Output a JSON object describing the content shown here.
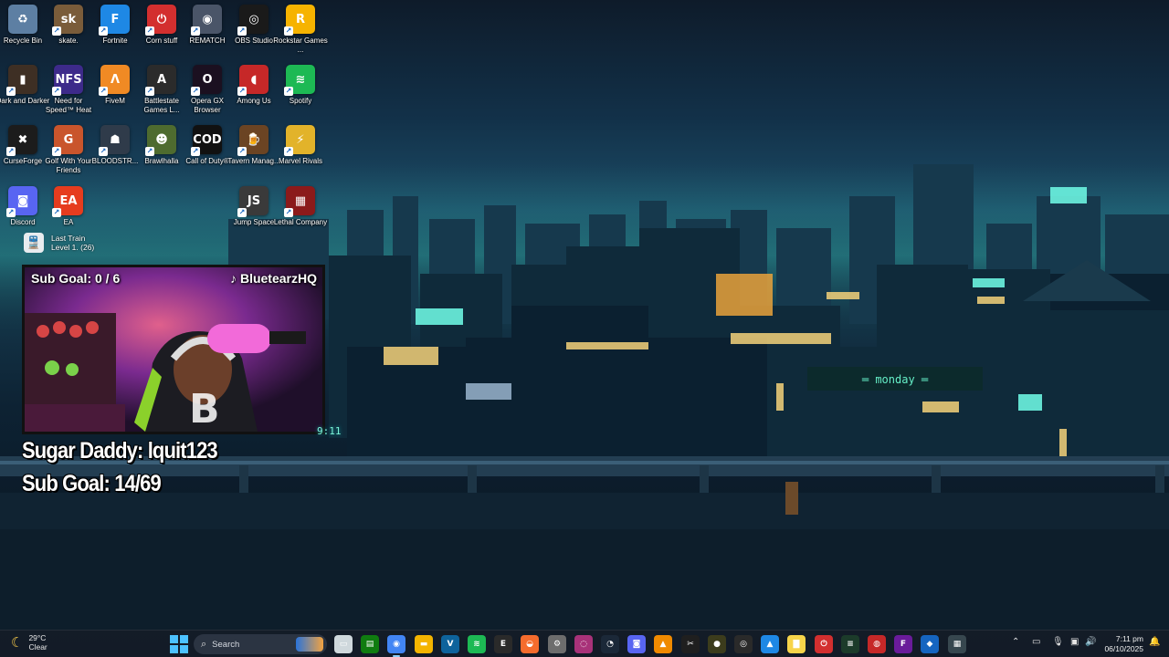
{
  "desktop": {
    "icons": [
      {
        "label": "Recycle Bin",
        "icon": "recycle-bin-icon",
        "color": "#5d7fa3",
        "glyph": "♻"
      },
      {
        "label": "skate.",
        "icon": "skate-game-icon",
        "color": "#7a5c3a",
        "glyph": "sk"
      },
      {
        "label": "Fortnite",
        "icon": "fortnite-icon",
        "color": "#1e88e5",
        "glyph": "F"
      },
      {
        "label": "Corn stuff",
        "icon": "power-button-icon",
        "color": "#d32f2f",
        "glyph": "⏻"
      },
      {
        "label": "REMATCH",
        "icon": "rematch-ball-icon",
        "color": "#4a5568",
        "glyph": "◉"
      },
      {
        "label": "OBS Studio",
        "icon": "obs-studio-icon",
        "color": "#1a1a1a",
        "glyph": "◎"
      },
      {
        "label": "Rockstar Games ...",
        "icon": "rockstar-games-icon",
        "color": "#f6b300",
        "glyph": "R"
      },
      {
        "label": "Dark and Darker",
        "icon": "dark-and-darker-icon",
        "color": "#3e2f24",
        "glyph": "▮"
      },
      {
        "label": "Need for Speed™ Heat",
        "icon": "need-for-speed-icon",
        "color": "#3d2a8a",
        "glyph": "NFS"
      },
      {
        "label": "FiveM",
        "icon": "fivem-icon",
        "color": "#f08a24",
        "glyph": "Λ"
      },
      {
        "label": "Battlestate Games L...",
        "icon": "battlestate-games-icon",
        "color": "#2b2b2b",
        "glyph": "A"
      },
      {
        "label": "Opera GX Browser",
        "icon": "opera-gx-icon",
        "color": "#1b1020",
        "glyph": "O"
      },
      {
        "label": "Among Us",
        "icon": "among-us-icon",
        "color": "#c62828",
        "glyph": "◖"
      },
      {
        "label": "Spotify",
        "icon": "spotify-icon",
        "color": "#1db954",
        "glyph": "≋"
      },
      {
        "label": "CurseForge",
        "icon": "curseforge-icon",
        "color": "#1c1c1c",
        "glyph": "✖"
      },
      {
        "label": "Golf With Your Friends",
        "icon": "golf-with-friends-icon",
        "color": "#c9552c",
        "glyph": "G"
      },
      {
        "label": "BLOODSTR...",
        "icon": "bloodstrike-icon",
        "color": "#2f3b4a",
        "glyph": "☗"
      },
      {
        "label": "Brawlhalla",
        "icon": "brawlhalla-icon",
        "color": "#4e6b2f",
        "glyph": "☻"
      },
      {
        "label": "Call of Duty®",
        "icon": "call-of-duty-icon",
        "color": "#111111",
        "glyph": "COD"
      },
      {
        "label": "Tavern Manag...",
        "icon": "tavern-manager-icon",
        "color": "#6b4423",
        "glyph": "🍺"
      },
      {
        "label": "Marvel Rivals",
        "icon": "marvel-rivals-icon",
        "color": "#e2b32a",
        "glyph": "⚡"
      },
      {
        "label": "Discord",
        "icon": "discord-icon",
        "color": "#5865f2",
        "glyph": "◙"
      },
      {
        "label": "EA",
        "icon": "ea-icon",
        "color": "#e63c1e",
        "glyph": "EA"
      },
      {
        "label": "Jump Space",
        "icon": "jump-space-icon",
        "color": "#3a3a3a",
        "glyph": "JS"
      },
      {
        "label": "Lethal Company",
        "icon": "lethal-company-icon",
        "color": "#8b1a1a",
        "glyph": "▦"
      }
    ],
    "train": {
      "line1": "Last Train",
      "line2": "Level 1. (26)",
      "icon": "train-icon"
    }
  },
  "stream_overlay": {
    "cam_sub_goal": "Sub Goal: 0 / 6",
    "cam_username": "BluetearzHQ",
    "sugar_daddy": "Sugar Daddy: lquit123",
    "sub_goal": "Sub Goal: 14/69",
    "timer": "9:11"
  },
  "taskbar": {
    "weather": {
      "temp": "29°C",
      "condition": "Clear",
      "icon": "moon-icon"
    },
    "search": {
      "placeholder": "Search"
    },
    "apps": [
      {
        "name": "file-explorer-icon",
        "color": "#cfd8dc",
        "glyph": "▭"
      },
      {
        "name": "xbox-app-icon",
        "color": "#107c10",
        "glyph": "▤"
      },
      {
        "name": "chrome-icon",
        "color": "#4285f4",
        "glyph": "◉",
        "active": true
      },
      {
        "name": "folder-icon",
        "color": "#f4b400",
        "glyph": "▬"
      },
      {
        "name": "vscode-icon",
        "color": "#0e639c",
        "glyph": "V"
      },
      {
        "name": "spotify-taskbar-icon",
        "color": "#1db954",
        "glyph": "≋"
      },
      {
        "name": "epic-games-icon",
        "color": "#2a2a2a",
        "glyph": "E"
      },
      {
        "name": "origin-icon",
        "color": "#f56c2d",
        "glyph": "◒"
      },
      {
        "name": "settings-app-icon",
        "color": "#6d6d6d",
        "glyph": "⚙"
      },
      {
        "name": "gx-app-icon",
        "color": "#a83279",
        "glyph": "◌"
      },
      {
        "name": "steam-icon",
        "color": "#1b2838",
        "glyph": "◔"
      },
      {
        "name": "discord-taskbar-icon",
        "color": "#5865f2",
        "glyph": "◙"
      },
      {
        "name": "vlc-icon",
        "color": "#f08a00",
        "glyph": "▲"
      },
      {
        "name": "capcut-icon",
        "color": "#1f1f1f",
        "glyph": "✂"
      },
      {
        "name": "game-app-icon",
        "color": "#3c3c1c",
        "glyph": "●"
      },
      {
        "name": "obs-taskbar-icon",
        "color": "#2a2a2a",
        "glyph": "◎"
      },
      {
        "name": "photos-icon",
        "color": "#1e88e5",
        "glyph": "▲"
      },
      {
        "name": "sticky-notes-icon",
        "color": "#f7d44a",
        "glyph": "▇"
      },
      {
        "name": "power-app-icon",
        "color": "#d32f2f",
        "glyph": "⏻"
      },
      {
        "name": "terminal-icon",
        "color": "#1c3b2a",
        "glyph": "≡"
      },
      {
        "name": "red-app-icon",
        "color": "#c62828",
        "glyph": "◍"
      },
      {
        "name": "f-app-icon",
        "color": "#6a1b9a",
        "glyph": "F"
      },
      {
        "name": "blue-app-icon",
        "color": "#1565c0",
        "glyph": "◆"
      },
      {
        "name": "round-app-icon",
        "color": "#37474f",
        "glyph": "▦"
      }
    ],
    "clock": {
      "time": "7:11 pm",
      "date": "06/10/2025"
    }
  },
  "colors": {
    "taskbar": "#141c28",
    "accent": "#4cc2ff"
  }
}
